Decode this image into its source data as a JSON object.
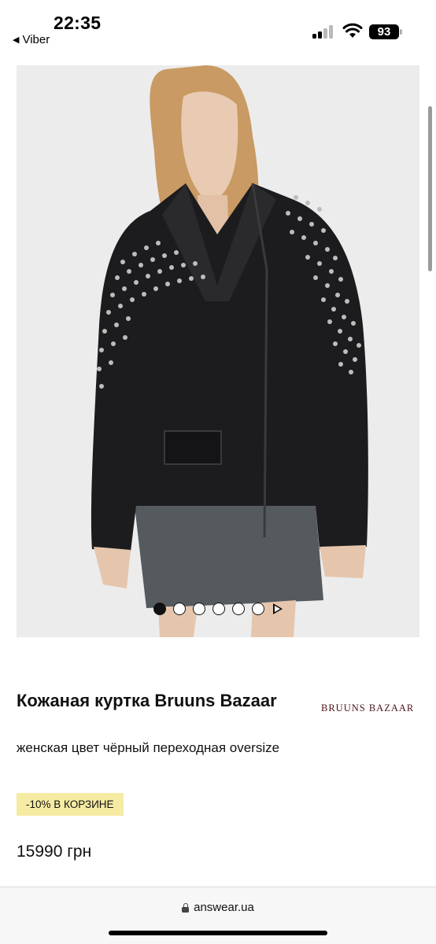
{
  "status_bar": {
    "time": "22:35",
    "back_app": "Viber",
    "battery": "93"
  },
  "product": {
    "title": "Кожаная куртка Bruuns Bazaar",
    "subtitle": "женская цвет чёрный переходная oversize",
    "brand_logo": "BRUUNS BAZAAR",
    "promo": "-10% В КОРЗИНЕ",
    "price": "15990 грн"
  },
  "gallery": {
    "dot_count": 6,
    "active_index": 0
  },
  "browser": {
    "url": "answear.ua"
  },
  "colors": {
    "promo_bg": "#f5eba2",
    "brand_logo": "#4a1418"
  }
}
